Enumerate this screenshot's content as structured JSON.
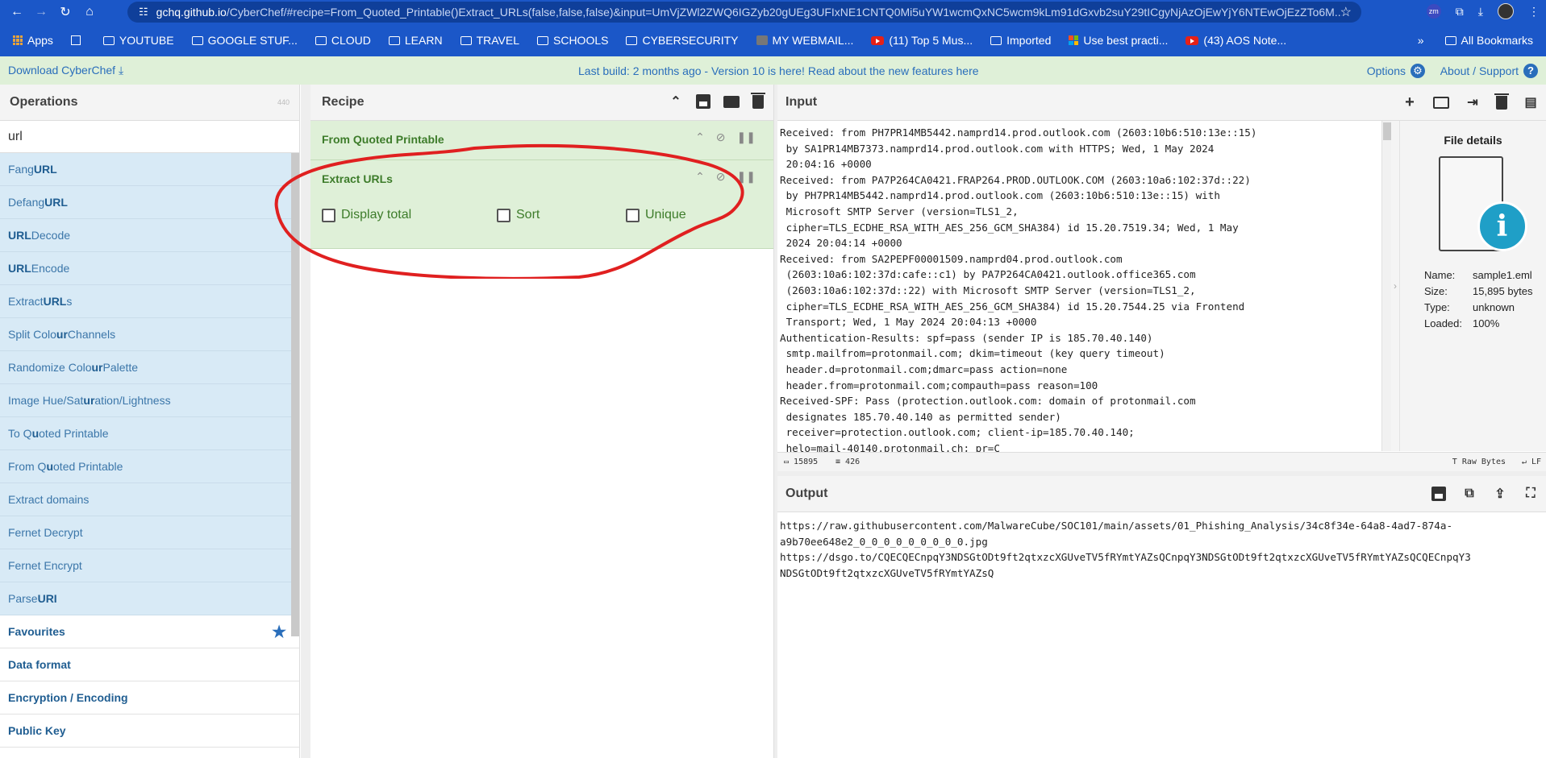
{
  "browser": {
    "url_host": "gchq.github.io",
    "url_path": "/CyberChef/#recipe=From_Quoted_Printable()Extract_URLs(false,false,false)&input=UmVjZWl2ZWQ6IGZyb20gUEg3UFIxNE1CNTQ0Mi5uYW1wcmQxNC5wcm9kLm91dGxvb2suY29tICgyNjAzOjEwYjY6NTEwOjEzZTo6M..."
  },
  "bookmarks": [
    {
      "label": "Apps",
      "icon": "apps-icon"
    },
    {
      "label": "",
      "icon": "grid-icon"
    },
    {
      "label": "YOUTUBE",
      "icon": "folder-icon"
    },
    {
      "label": "GOOGLE STUF...",
      "icon": "folder-icon"
    },
    {
      "label": "CLOUD",
      "icon": "folder-icon"
    },
    {
      "label": "LEARN",
      "icon": "folder-icon"
    },
    {
      "label": "TRAVEL",
      "icon": "folder-icon"
    },
    {
      "label": "SCHOOLS",
      "icon": "folder-icon"
    },
    {
      "label": "CYBERSECURITY",
      "icon": "folder-icon"
    },
    {
      "label": "MY WEBMAIL...",
      "icon": "mail-icon"
    },
    {
      "label": "(11) Top 5 Mus...",
      "icon": "youtube-icon"
    },
    {
      "label": "Imported",
      "icon": "folder-icon"
    },
    {
      "label": "Use best practi...",
      "icon": "microsoft-icon"
    },
    {
      "label": "(43) AOS Note...",
      "icon": "youtube-icon"
    }
  ],
  "bookmarks_right": {
    "more": "»",
    "all_bookmarks": "All Bookmarks"
  },
  "banner": {
    "download": "Download CyberChef",
    "notice": "Last build: 2 months ago - Version 10 is here! Read about the new features here",
    "options": "Options",
    "about": "About / Support"
  },
  "operations": {
    "title": "Operations",
    "count": "440",
    "search": "url",
    "results": [
      {
        "pre": "Fang ",
        "match": "URL",
        "post": ""
      },
      {
        "pre": "Defang ",
        "match": "URL",
        "post": ""
      },
      {
        "pre": "",
        "match": "URL",
        "post": " Decode"
      },
      {
        "pre": "",
        "match": "URL",
        "post": " Encode"
      },
      {
        "pre": "Extract ",
        "match": "URL",
        "post": "s"
      },
      {
        "pre": "Split Colo",
        "match": "ur",
        "post": " Channels"
      },
      {
        "pre": "Randomize Colo",
        "match": "ur",
        "post": " Palette"
      },
      {
        "pre": "Image Hue/Sat",
        "match": "ur",
        "post": "ation/Lightness"
      },
      {
        "pre": "To Q",
        "match": "u",
        "post": "oted Printable"
      },
      {
        "pre": "From Q",
        "match": "u",
        "post": "oted Printable"
      },
      {
        "pre": "Extract domains",
        "match": "",
        "post": ""
      },
      {
        "pre": "Fernet Decrypt",
        "match": "",
        "post": ""
      },
      {
        "pre": "Fernet Encrypt",
        "match": "",
        "post": ""
      },
      {
        "pre": "Parse ",
        "match": "URI",
        "post": ""
      }
    ],
    "categories": [
      "Favourites",
      "Data format",
      "Encryption / Encoding",
      "Public Key"
    ]
  },
  "recipe": {
    "title": "Recipe",
    "op1": "From Quoted Printable",
    "op2": "Extract URLs",
    "args": [
      "Display total",
      "Sort",
      "Unique"
    ]
  },
  "input": {
    "title": "Input",
    "text": "Received: from PH7PR14MB5442.namprd14.prod.outlook.com (2603:10b6:510:13e::15)\n by SA1PR14MB7373.namprd14.prod.outlook.com with HTTPS; Wed, 1 May 2024\n 20:04:16 +0000\nReceived: from PA7P264CA0421.FRAP264.PROD.OUTLOOK.COM (2603:10a6:102:37d::22)\n by PH7PR14MB5442.namprd14.prod.outlook.com (2603:10b6:510:13e::15) with\n Microsoft SMTP Server (version=TLS1_2,\n cipher=TLS_ECDHE_RSA_WITH_AES_256_GCM_SHA384) id 15.20.7519.34; Wed, 1 May\n 2024 20:04:14 +0000\nReceived: from SA2PEPF00001509.namprd04.prod.outlook.com\n (2603:10a6:102:37d:cafe::c1) by PA7P264CA0421.outlook.office365.com\n (2603:10a6:102:37d::22) with Microsoft SMTP Server (version=TLS1_2,\n cipher=TLS_ECDHE_RSA_WITH_AES_256_GCM_SHA384) id 15.20.7544.25 via Frontend\n Transport; Wed, 1 May 2024 20:04:13 +0000\nAuthentication-Results: spf=pass (sender IP is 185.70.40.140)\n smtp.mailfrom=protonmail.com; dkim=timeout (key query timeout)\n header.d=protonmail.com;dmarc=pass action=none\n header.from=protonmail.com;compauth=pass reason=100\nReceived-SPF: Pass (protection.outlook.com: domain of protonmail.com\n designates 185.70.40.140 as permitted sender)\n receiver=protection.outlook.com; client-ip=185.70.40.140;\n helo=mail-40140.protonmail.ch; pr=C",
    "length": "15895",
    "lines": "426",
    "raw_bytes": "Raw Bytes",
    "eol": "LF"
  },
  "file_details": {
    "title": "File details",
    "name_label": "Name:",
    "name": "sample1.eml",
    "size_label": "Size:",
    "size": "15,895 bytes",
    "type_label": "Type:",
    "type": "unknown",
    "loaded_label": "Loaded:",
    "loaded": "100%"
  },
  "output": {
    "title": "Output",
    "text": "https://raw.githubusercontent.com/MalwareCube/SOC101/main/assets/01_Phishing_Analysis/34c8f34e-64a8-4ad7-874a-\na9b70ee648e2_0_0_0_0_0_0_0_0_0.jpg\nhttps://dsgo.to/CQECQECnpqY3NDSGtODt9ft2qtxzcXGUveTV5fRYmtYAZsQCnpqY3NDSGtODt9ft2qtxzcXGUveTV5fRYmtYAZsQCQECnpqY3\nNDSGtODt9ft2qtxzcXGUveTV5fRYmtYAZsQ"
  },
  "colors": {
    "chrome": "#1b57c8",
    "banner": "#dff0d8",
    "op_highlight": "#d8eaf6",
    "annotation": "#e02020"
  }
}
